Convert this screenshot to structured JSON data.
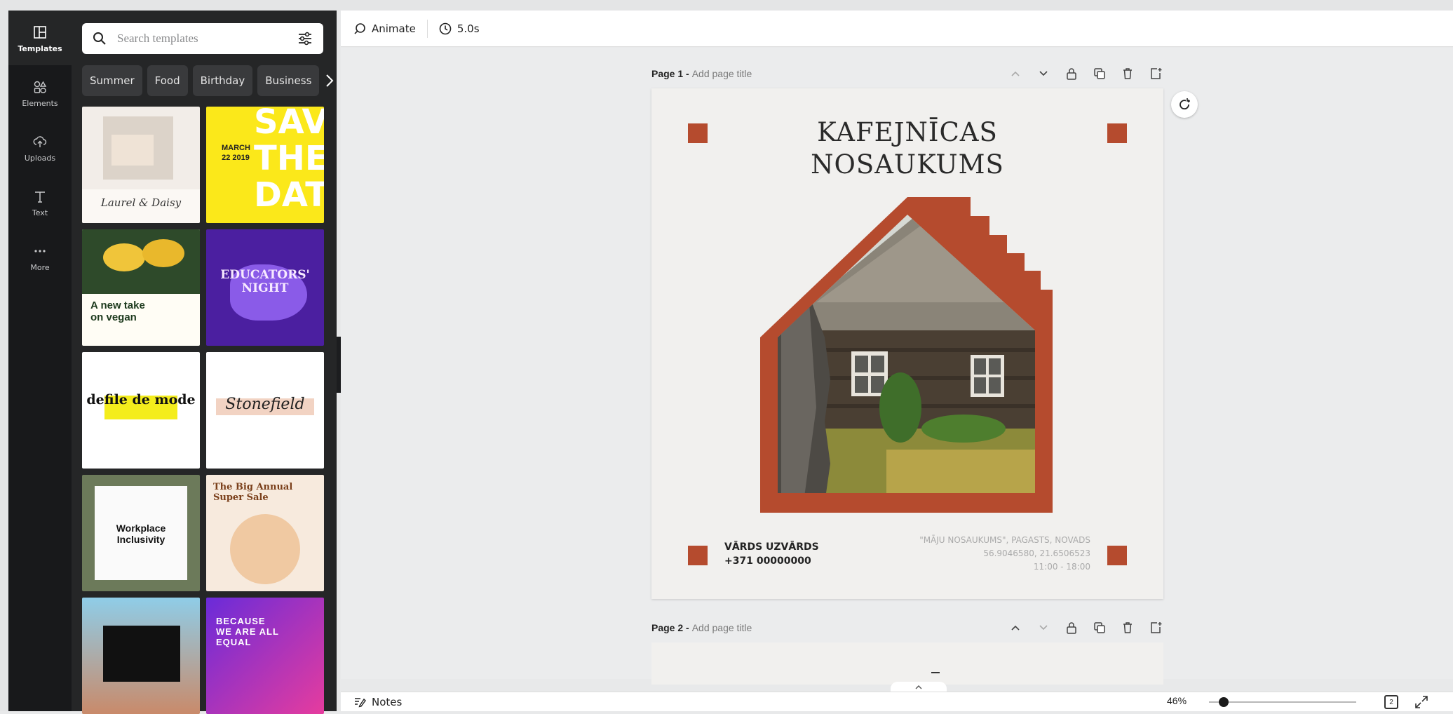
{
  "rail": [
    {
      "label": "Templates",
      "icon": "templates-icon",
      "active": true
    },
    {
      "label": "Elements",
      "icon": "elements-icon",
      "active": false
    },
    {
      "label": "Uploads",
      "icon": "uploads-icon",
      "active": false
    },
    {
      "label": "Text",
      "icon": "text-icon",
      "active": false
    },
    {
      "label": "More",
      "icon": "more-icon",
      "active": false
    }
  ],
  "search": {
    "placeholder": "Search templates"
  },
  "chips": [
    "Summer",
    "Food",
    "Birthday",
    "Business"
  ],
  "templates": [
    {
      "name": "template-laurel-daisy",
      "text": "Laurel & Daisy"
    },
    {
      "name": "template-save-the-date",
      "text": "SAVE THE DATE",
      "date": "MARCH 22 2019"
    },
    {
      "name": "template-vegan",
      "text": "A new take on vegan"
    },
    {
      "name": "template-educators-night",
      "text": "EDUCATORS' NIGHT"
    },
    {
      "name": "template-defile-de-mode",
      "text": "defile de mode"
    },
    {
      "name": "template-stonefield",
      "text": "Stonefield"
    },
    {
      "name": "template-workplace-inclusivity",
      "text": "Workplace Inclusivity"
    },
    {
      "name": "template-big-annual-sale",
      "text": "The Big Annual Super Sale"
    },
    {
      "name": "template-palm-trees",
      "text": ""
    },
    {
      "name": "template-because-we-are-all-equal",
      "text": "BECAUSE WE ARE ALL EQUAL"
    }
  ],
  "toolbar": {
    "animate_label": "Animate",
    "duration_label": "5.0s"
  },
  "page1": {
    "number_label": "Page 1 -",
    "title_placeholder": "Add page title",
    "heading_line1": "KAFEJNĪCAS",
    "heading_line2": "NOSAUKUMS",
    "contact_name": "VĀRDS UZVĀRDS",
    "contact_phone": "+371 00000000",
    "address_line1": "\"MĀJU NOSAUKUMS\", PAGASTS, NOVADS",
    "address_line2": "56.9046580, 21.6506523",
    "address_line3": "11:00 - 18:00",
    "accent_color": "#b54b2e"
  },
  "page2": {
    "number_label": "Page 2 -",
    "title_placeholder": "Add page title"
  },
  "bottombar": {
    "notes_label": "Notes",
    "zoom_label": "46%",
    "zoom_value": 0.46,
    "page_count": "2"
  }
}
